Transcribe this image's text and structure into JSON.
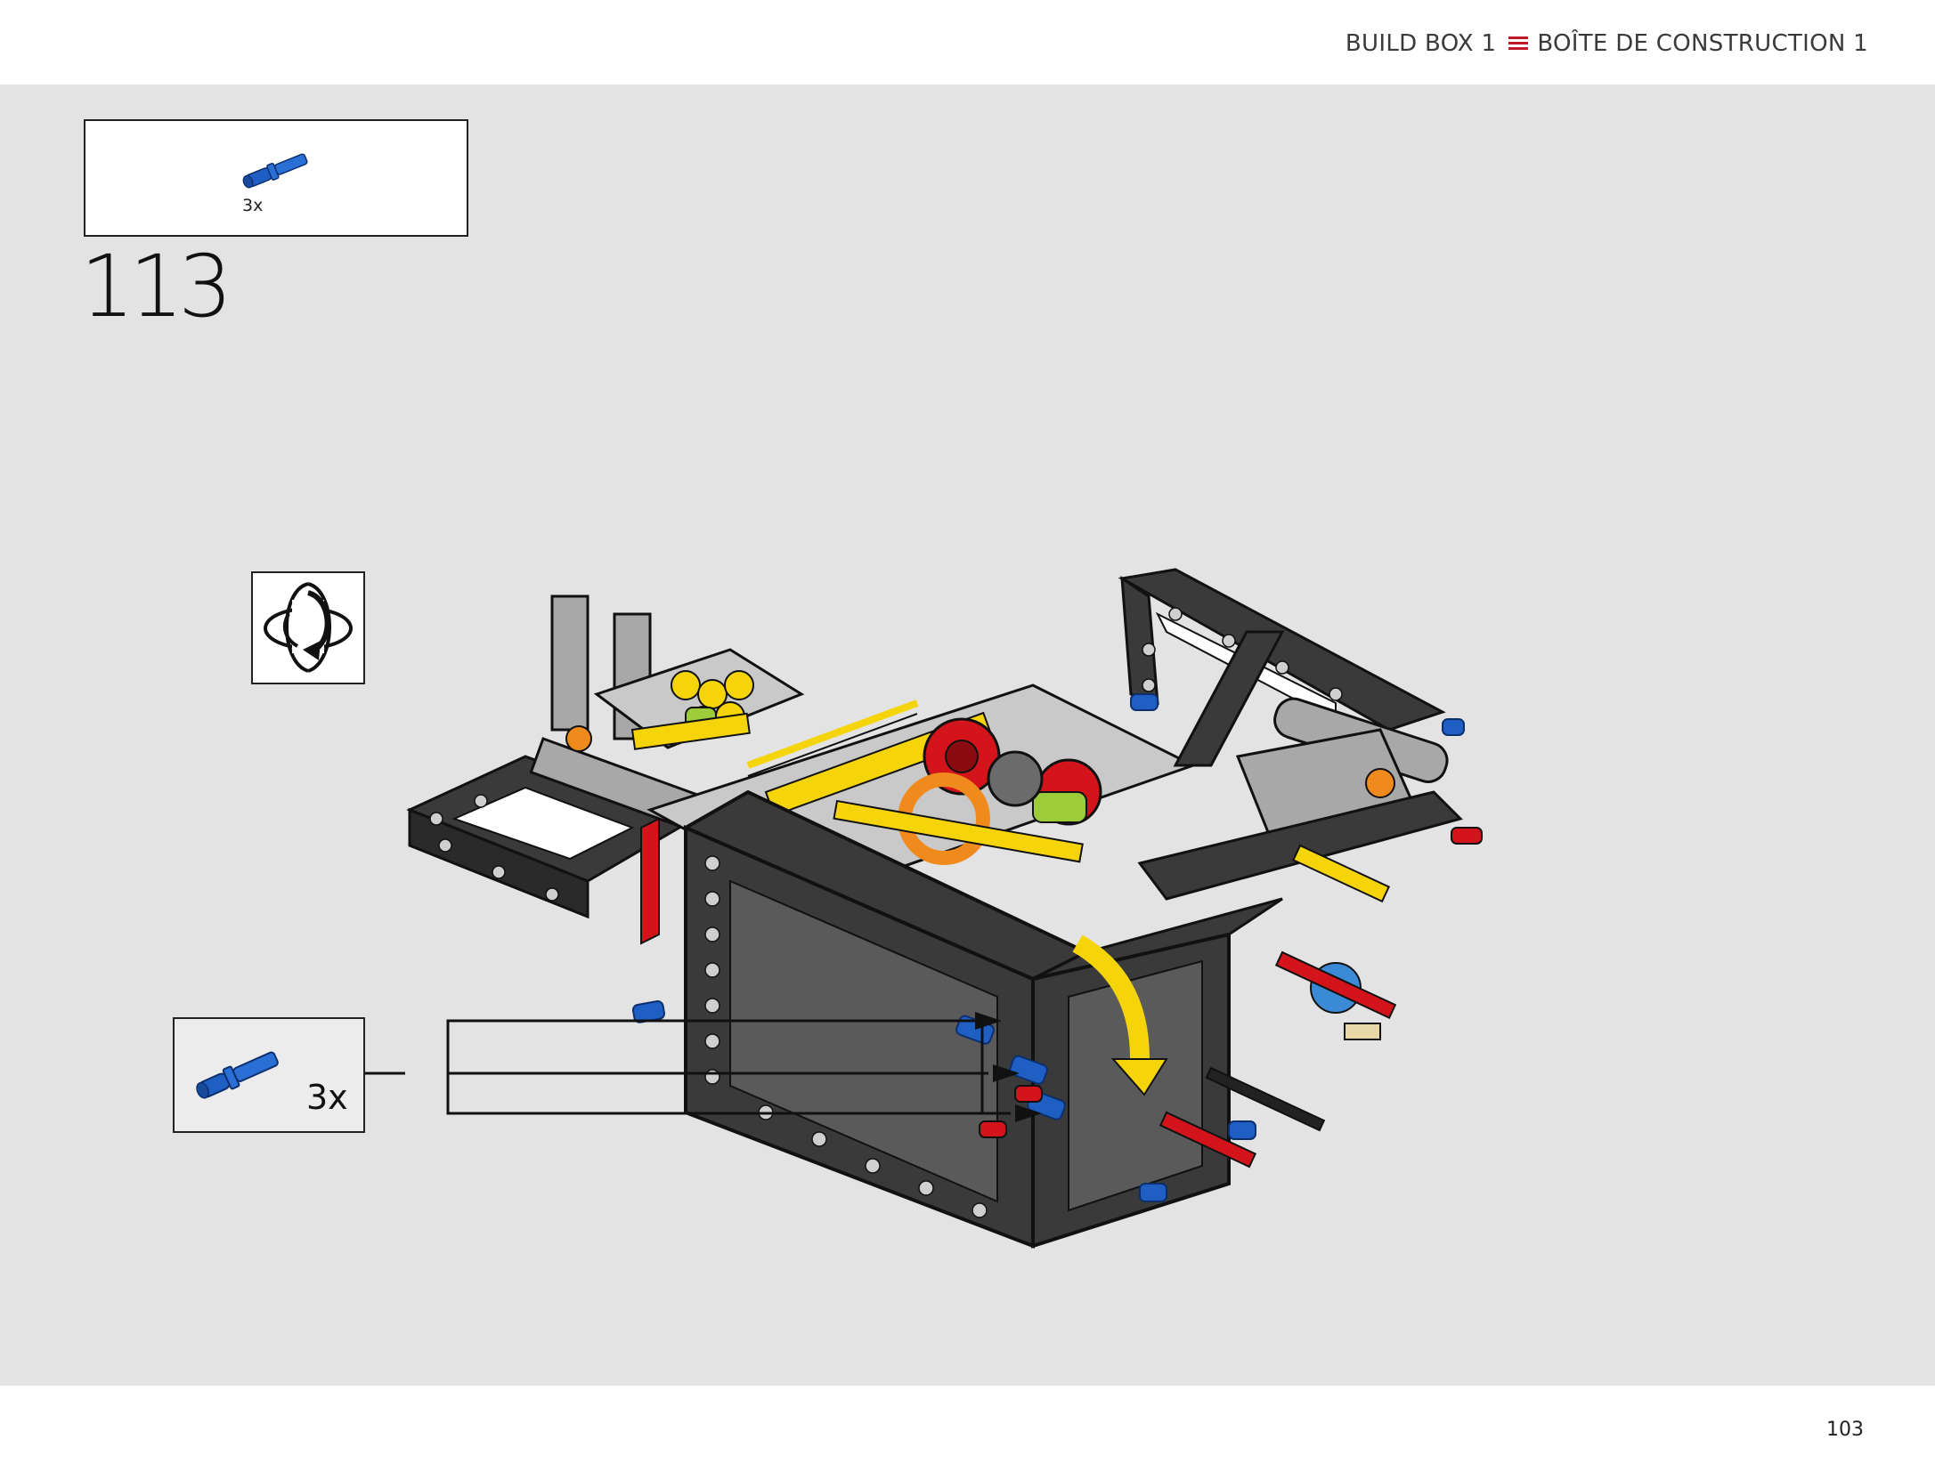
{
  "header": {
    "title_en": "BUILD BOX 1",
    "title_fr": "BOÎTE DE CONSTRUCTION 1",
    "menu_icon": "menu-lines-icon",
    "accent_color": "#c0182a"
  },
  "parts_list": {
    "items": [
      {
        "part": "blue-axle-pin-icon",
        "color": "#1f5fc4",
        "quantity": "3x"
      }
    ]
  },
  "step": {
    "number": "113"
  },
  "rotate_icon": "rotate-model-icon",
  "callout": {
    "part": "blue-axle-pin-icon",
    "quantity": "3x"
  },
  "page": {
    "number": "103"
  },
  "colors": {
    "background": "#e3e3e3",
    "frame": "#3a3a3a",
    "red": "#d4141b",
    "yellow": "#f5d50a",
    "blue": "#1f5fc4",
    "light_gray": "#a8a8a8",
    "orange": "#f08a1d",
    "lime": "#9ccc3a"
  }
}
